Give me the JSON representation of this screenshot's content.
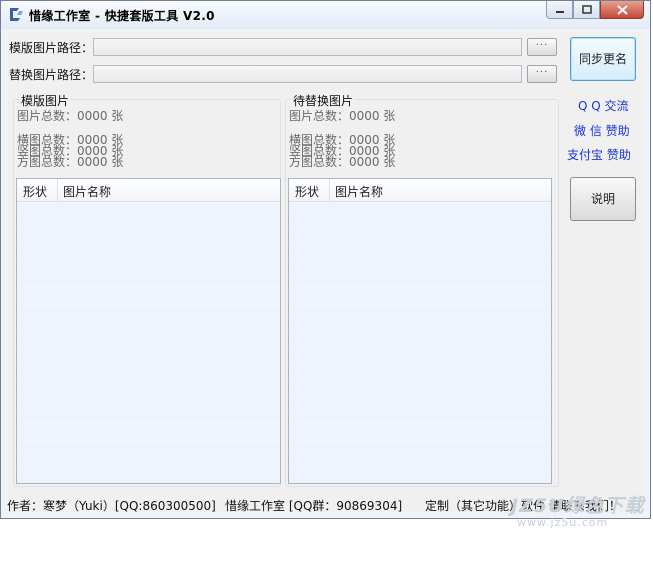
{
  "window": {
    "title": "惜缘工作室 - 快捷套版工具 V2.0",
    "controls": {
      "minimize": "minimize-icon",
      "maximize": "maximize-icon",
      "close": "close-icon"
    }
  },
  "paths": {
    "template_label": "模版图片路径：",
    "template_value": "",
    "replace_label": "替换图片路径：",
    "replace_value": "",
    "browse_label": "···"
  },
  "buttons": {
    "sync_rename": "同步更名",
    "help": "说明"
  },
  "links": {
    "qq": "Q Q 交流",
    "wechat": "微 信 赞助",
    "alipay": "支付宝 赞助"
  },
  "left_panel": {
    "title": "模版图片",
    "total": "图片总数：0000 张",
    "landscape": "横图总数：0000 张",
    "portrait": "竖图总数：0000 张",
    "square": "方图总数：0000 张",
    "columns": [
      "形状",
      "图片名称"
    ]
  },
  "right_panel": {
    "title": "待替换图片",
    "total": "图片总数：0000 张",
    "landscape": "横图总数：0000 张",
    "portrait": "竖图总数：0000 张",
    "square": "方图总数：0000 张",
    "columns": [
      "形状",
      "图片名称"
    ]
  },
  "status": {
    "author": "作者：寒梦（Yuki）[QQ:860300500]",
    "studio": "惜缘工作室 [QQ群：90869304]",
    "custom": "定制（其它功能）软件 请联系我们！"
  },
  "watermark": {
    "line1": "JZ5U绿色下载",
    "line2": "www.jz5u.com"
  },
  "colors": {
    "link": "#1a35d4",
    "accent_border": "#4d9fd6",
    "close_button": "#c4493a"
  }
}
